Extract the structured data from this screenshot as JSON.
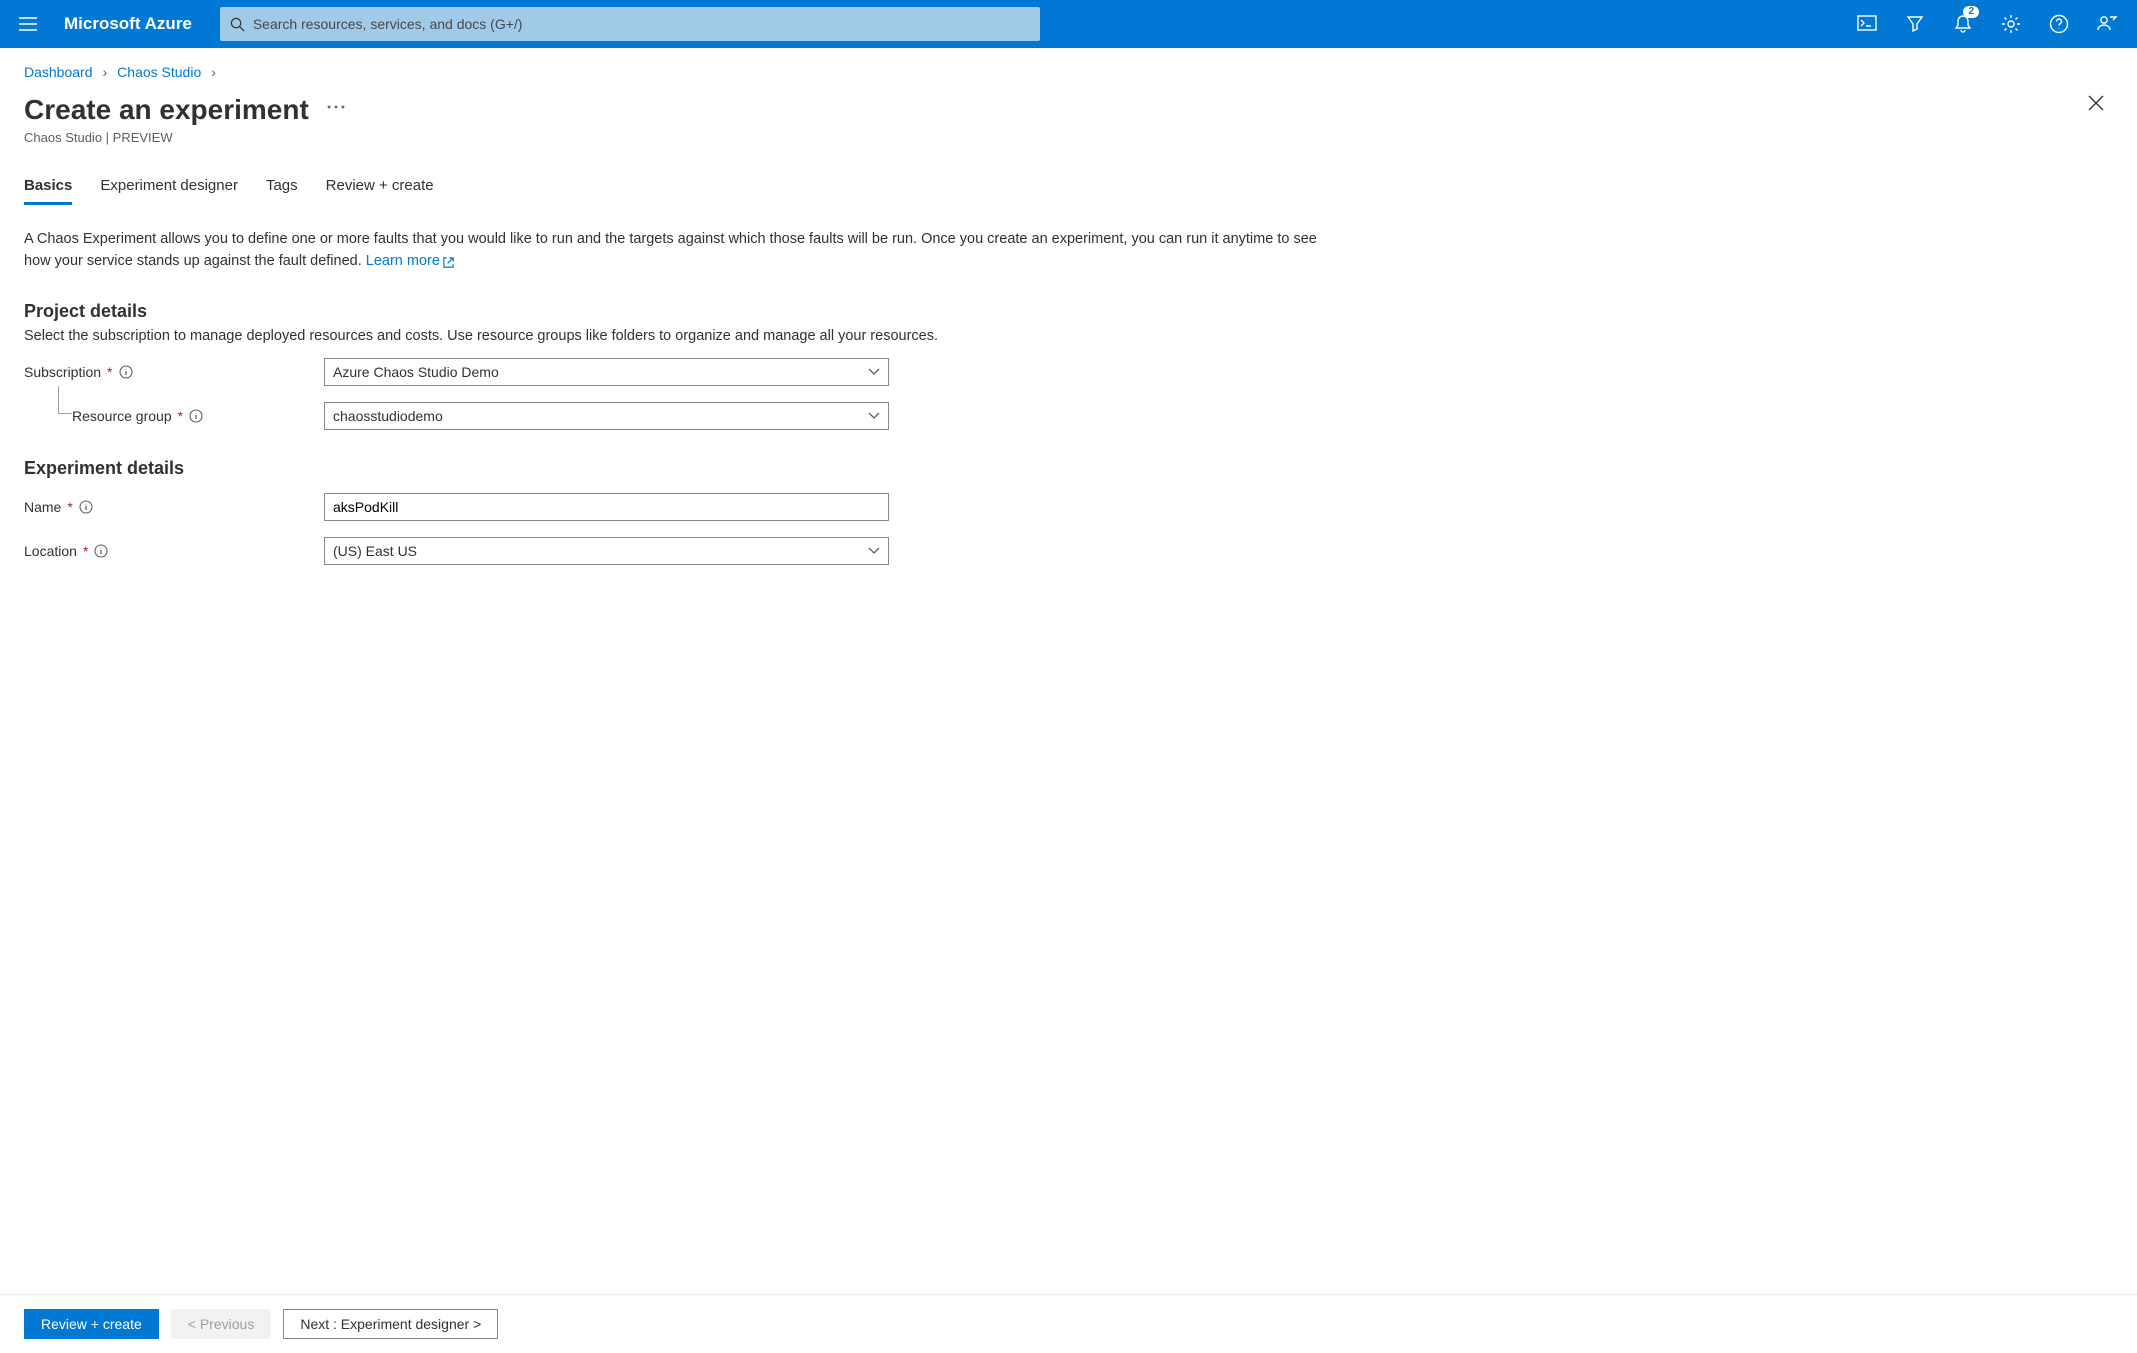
{
  "header": {
    "brand": "Microsoft Azure",
    "search_placeholder": "Search resources, services, and docs (G+/)",
    "notification_count": "2"
  },
  "breadcrumb": {
    "items": [
      "Dashboard",
      "Chaos Studio"
    ]
  },
  "page": {
    "title": "Create an experiment",
    "subtitle": "Chaos Studio | PREVIEW"
  },
  "tabs": [
    "Basics",
    "Experiment designer",
    "Tags",
    "Review + create"
  ],
  "basics": {
    "description": "A Chaos Experiment allows you to define one or more faults that you would like to run and the targets against which those faults will be run. Once you create an experiment, you can run it anytime to see how your service stands up against the fault defined.",
    "learn_more": "Learn more",
    "project_details": {
      "heading": "Project details",
      "sub": "Select the subscription to manage deployed resources and costs. Use resource groups like folders to organize and manage all your resources.",
      "subscription_label": "Subscription",
      "subscription_value": "Azure Chaos Studio Demo",
      "resource_group_label": "Resource group",
      "resource_group_value": "chaosstudiodemo"
    },
    "experiment_details": {
      "heading": "Experiment details",
      "name_label": "Name",
      "name_value": "aksPodKill",
      "location_label": "Location",
      "location_value": "(US) East US"
    }
  },
  "footer": {
    "review_create": "Review + create",
    "previous": "< Previous",
    "next": "Next : Experiment designer >"
  }
}
